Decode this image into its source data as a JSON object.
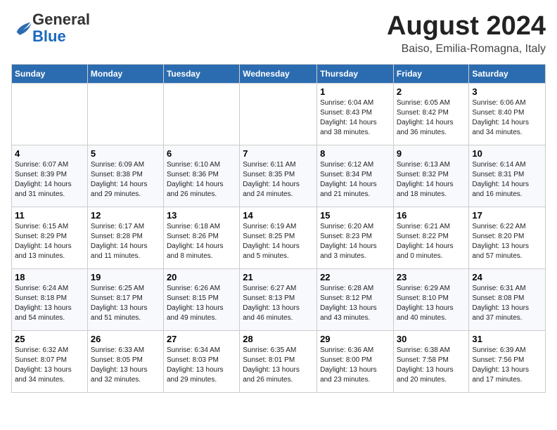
{
  "header": {
    "logo": {
      "line1": "General",
      "line2": "Blue"
    },
    "month": "August 2024",
    "location": "Baiso, Emilia-Romagna, Italy"
  },
  "weekdays": [
    "Sunday",
    "Monday",
    "Tuesday",
    "Wednesday",
    "Thursday",
    "Friday",
    "Saturday"
  ],
  "weeks": [
    [
      {
        "day": "",
        "info": ""
      },
      {
        "day": "",
        "info": ""
      },
      {
        "day": "",
        "info": ""
      },
      {
        "day": "",
        "info": ""
      },
      {
        "day": "1",
        "info": "Sunrise: 6:04 AM\nSunset: 8:43 PM\nDaylight: 14 hours\nand 38 minutes."
      },
      {
        "day": "2",
        "info": "Sunrise: 6:05 AM\nSunset: 8:42 PM\nDaylight: 14 hours\nand 36 minutes."
      },
      {
        "day": "3",
        "info": "Sunrise: 6:06 AM\nSunset: 8:40 PM\nDaylight: 14 hours\nand 34 minutes."
      }
    ],
    [
      {
        "day": "4",
        "info": "Sunrise: 6:07 AM\nSunset: 8:39 PM\nDaylight: 14 hours\nand 31 minutes."
      },
      {
        "day": "5",
        "info": "Sunrise: 6:09 AM\nSunset: 8:38 PM\nDaylight: 14 hours\nand 29 minutes."
      },
      {
        "day": "6",
        "info": "Sunrise: 6:10 AM\nSunset: 8:36 PM\nDaylight: 14 hours\nand 26 minutes."
      },
      {
        "day": "7",
        "info": "Sunrise: 6:11 AM\nSunset: 8:35 PM\nDaylight: 14 hours\nand 24 minutes."
      },
      {
        "day": "8",
        "info": "Sunrise: 6:12 AM\nSunset: 8:34 PM\nDaylight: 14 hours\nand 21 minutes."
      },
      {
        "day": "9",
        "info": "Sunrise: 6:13 AM\nSunset: 8:32 PM\nDaylight: 14 hours\nand 18 minutes."
      },
      {
        "day": "10",
        "info": "Sunrise: 6:14 AM\nSunset: 8:31 PM\nDaylight: 14 hours\nand 16 minutes."
      }
    ],
    [
      {
        "day": "11",
        "info": "Sunrise: 6:15 AM\nSunset: 8:29 PM\nDaylight: 14 hours\nand 13 minutes."
      },
      {
        "day": "12",
        "info": "Sunrise: 6:17 AM\nSunset: 8:28 PM\nDaylight: 14 hours\nand 11 minutes."
      },
      {
        "day": "13",
        "info": "Sunrise: 6:18 AM\nSunset: 8:26 PM\nDaylight: 14 hours\nand 8 minutes."
      },
      {
        "day": "14",
        "info": "Sunrise: 6:19 AM\nSunset: 8:25 PM\nDaylight: 14 hours\nand 5 minutes."
      },
      {
        "day": "15",
        "info": "Sunrise: 6:20 AM\nSunset: 8:23 PM\nDaylight: 14 hours\nand 3 minutes."
      },
      {
        "day": "16",
        "info": "Sunrise: 6:21 AM\nSunset: 8:22 PM\nDaylight: 14 hours\nand 0 minutes."
      },
      {
        "day": "17",
        "info": "Sunrise: 6:22 AM\nSunset: 8:20 PM\nDaylight: 13 hours\nand 57 minutes."
      }
    ],
    [
      {
        "day": "18",
        "info": "Sunrise: 6:24 AM\nSunset: 8:18 PM\nDaylight: 13 hours\nand 54 minutes."
      },
      {
        "day": "19",
        "info": "Sunrise: 6:25 AM\nSunset: 8:17 PM\nDaylight: 13 hours\nand 51 minutes."
      },
      {
        "day": "20",
        "info": "Sunrise: 6:26 AM\nSunset: 8:15 PM\nDaylight: 13 hours\nand 49 minutes."
      },
      {
        "day": "21",
        "info": "Sunrise: 6:27 AM\nSunset: 8:13 PM\nDaylight: 13 hours\nand 46 minutes."
      },
      {
        "day": "22",
        "info": "Sunrise: 6:28 AM\nSunset: 8:12 PM\nDaylight: 13 hours\nand 43 minutes."
      },
      {
        "day": "23",
        "info": "Sunrise: 6:29 AM\nSunset: 8:10 PM\nDaylight: 13 hours\nand 40 minutes."
      },
      {
        "day": "24",
        "info": "Sunrise: 6:31 AM\nSunset: 8:08 PM\nDaylight: 13 hours\nand 37 minutes."
      }
    ],
    [
      {
        "day": "25",
        "info": "Sunrise: 6:32 AM\nSunset: 8:07 PM\nDaylight: 13 hours\nand 34 minutes."
      },
      {
        "day": "26",
        "info": "Sunrise: 6:33 AM\nSunset: 8:05 PM\nDaylight: 13 hours\nand 32 minutes."
      },
      {
        "day": "27",
        "info": "Sunrise: 6:34 AM\nSunset: 8:03 PM\nDaylight: 13 hours\nand 29 minutes."
      },
      {
        "day": "28",
        "info": "Sunrise: 6:35 AM\nSunset: 8:01 PM\nDaylight: 13 hours\nand 26 minutes."
      },
      {
        "day": "29",
        "info": "Sunrise: 6:36 AM\nSunset: 8:00 PM\nDaylight: 13 hours\nand 23 minutes."
      },
      {
        "day": "30",
        "info": "Sunrise: 6:38 AM\nSunset: 7:58 PM\nDaylight: 13 hours\nand 20 minutes."
      },
      {
        "day": "31",
        "info": "Sunrise: 6:39 AM\nSunset: 7:56 PM\nDaylight: 13 hours\nand 17 minutes."
      }
    ]
  ]
}
